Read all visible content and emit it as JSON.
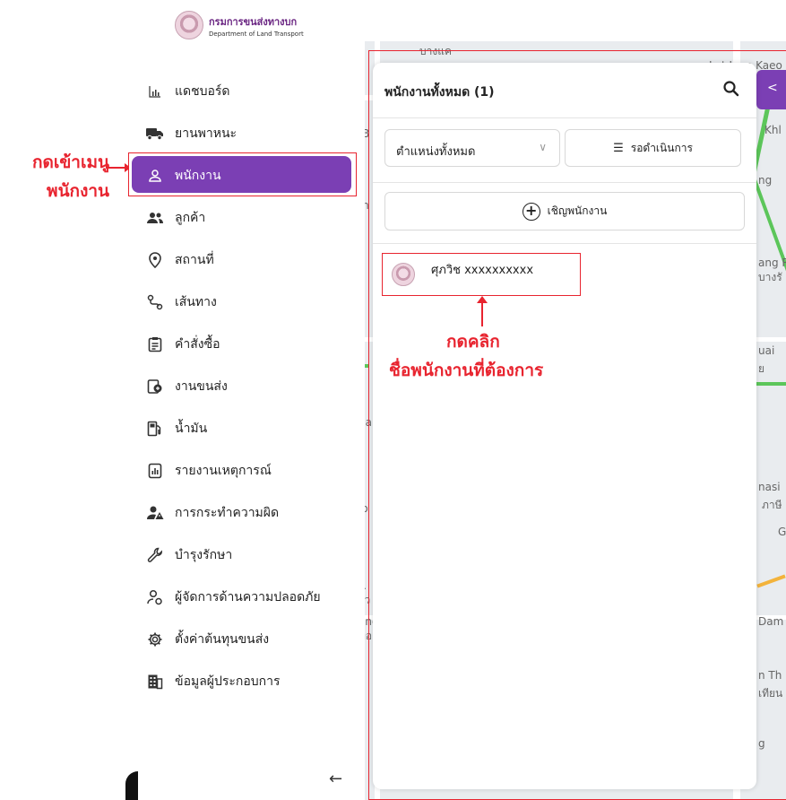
{
  "brand": {
    "name_th": "กรมการขนส่งทางบก",
    "name_en": "Department of Land Transport"
  },
  "sidebar": {
    "items": [
      {
        "label": "แดชบอร์ด",
        "icon": "bar-chart-icon"
      },
      {
        "label": "ยานพาหนะ",
        "icon": "truck-icon"
      },
      {
        "label": "พนักงาน",
        "icon": "person-icon",
        "active": true
      },
      {
        "label": "ลูกค้า",
        "icon": "group-icon"
      },
      {
        "label": "สถานที่",
        "icon": "location-pin-icon"
      },
      {
        "label": "เส้นทาง",
        "icon": "route-icon"
      },
      {
        "label": "คำสั่งซื้อ",
        "icon": "clipboard-icon"
      },
      {
        "label": "งานขนส่ง",
        "icon": "delivery-icon"
      },
      {
        "label": "น้ำมัน",
        "icon": "fuel-icon"
      },
      {
        "label": "รายงานเหตุการณ์",
        "icon": "report-icon"
      },
      {
        "label": "การกระทำความผิด",
        "icon": "warning-person-icon"
      },
      {
        "label": "บำรุงรักษา",
        "icon": "wrench-icon"
      },
      {
        "label": "ผู้จัดการด้านความปลอดภัย",
        "icon": "safety-manager-icon"
      },
      {
        "label": "ตั้งค่าต้นทุนขนส่ง",
        "icon": "gear-icon"
      },
      {
        "label": "ข้อมูลผู้ประกอบการ",
        "icon": "building-icon"
      }
    ],
    "collapse_icon": "arrow-left-icon"
  },
  "panel": {
    "title": "พนักงานทั้งหมด (1)",
    "filter_select": "ตำแหน่งทั้งหมด",
    "pending_button": "รอดำเนินการ",
    "invite_button": "เชิญพนักงาน",
    "employees": [
      {
        "name": "ศุภวิช xxxxxxxxxx"
      }
    ]
  },
  "annotations": {
    "menu_hint_line1": "กดเข้าเมนู",
    "menu_hint_line2": "พนักงาน",
    "click_hint_line1": "กดคลิก",
    "click_hint_line2": "ชื่อพนักงานที่ต้องการ",
    "highlight_color": "#e8242f"
  },
  "map_labels": [
    "Lat Lum Kaeo",
    "Khl",
    "ng",
    "ang R",
    "บางรั",
    "uai",
    "ย",
    "nasi",
    "ภาษี",
    "G",
    "Dam",
    "n Th",
    "เทียน",
    "g",
    "ha",
    "lo",
    "m",
    "B",
    "R",
    "รัว",
    "ong",
    "ทอง",
    "บางแค"
  ],
  "colors": {
    "accent": "#7b3fb4",
    "annotation": "#e8242f"
  }
}
